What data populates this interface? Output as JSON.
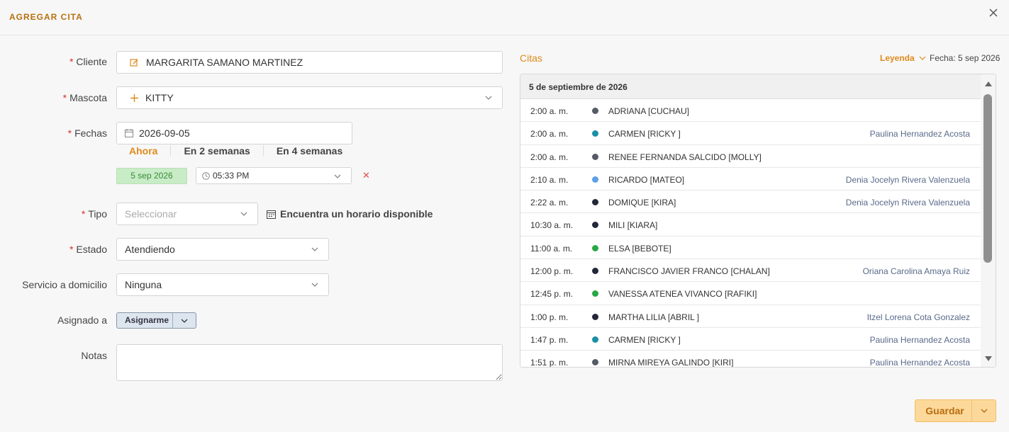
{
  "header": {
    "title": "AGREGAR CITA",
    "close_icon": "close-icon"
  },
  "form": {
    "cliente": {
      "label": "Cliente",
      "required_mark": "*",
      "value": "MARGARITA SAMANO MARTINEZ",
      "icon": "edit-icon"
    },
    "mascota": {
      "label": "Mascota",
      "required_mark": "*",
      "value": "KITTY",
      "icon": "plus-icon"
    },
    "fechas": {
      "label": "Fechas",
      "required_mark": "*",
      "value": "2026-09-05",
      "icon": "calendar-icon",
      "quick_links": [
        "Ahora",
        "En 2 semanas",
        "En 4 semanas"
      ],
      "selected_chip": "5 sep 2026",
      "time_value": "05:33 PM",
      "remove_mark": "✕"
    },
    "tipo": {
      "label": "Tipo",
      "required_mark": "*",
      "placeholder": "Seleccionar",
      "find_slot": "Encuentra un horario disponible"
    },
    "estado": {
      "label": "Estado",
      "required_mark": "*",
      "value": "Atendiendo"
    },
    "servicio": {
      "label": "Servicio a domicilio",
      "value": "Ninguna"
    },
    "asignado": {
      "label": "Asignado a",
      "button": "Asignarme"
    },
    "notas": {
      "label": "Notas",
      "value": ""
    }
  },
  "citas": {
    "title": "Citas",
    "legend_label": "Leyenda",
    "fecha_label": "Fecha: 5 sep 2026",
    "day_header": "5 de septiembre de 2026",
    "colors": {
      "gray": "#555b66",
      "teal": "#1a8fa6",
      "blue": "#5ea0e8",
      "dark": "#232838",
      "green": "#28a745"
    },
    "rows": [
      {
        "time": "2:00 a. m.",
        "color": "#555b66",
        "name": "ADRIANA [CUCHAU]",
        "vet": ""
      },
      {
        "time": "2:00 a. m.",
        "color": "#1a8fa6",
        "name": "CARMEN [RICKY ]",
        "vet": "Paulina Hernandez Acosta"
      },
      {
        "time": "2:00 a. m.",
        "color": "#555b66",
        "name": "RENEE FERNANDA SALCIDO [MOLLY]",
        "vet": ""
      },
      {
        "time": "2:10 a. m.",
        "color": "#5ea0e8",
        "name": "RICARDO [MATEO]",
        "vet": "Denia Jocelyn Rivera Valenzuela"
      },
      {
        "time": "2:22 a. m.",
        "color": "#232838",
        "name": "DOMIQUE [KIRA]",
        "vet": "Denia Jocelyn Rivera Valenzuela"
      },
      {
        "time": "10:30 a. m.",
        "color": "#232838",
        "name": "MILI [KIARA]",
        "vet": ""
      },
      {
        "time": "11:00 a. m.",
        "color": "#28a745",
        "name": "ELSA [BEBOTE]",
        "vet": ""
      },
      {
        "time": "12:00 p. m.",
        "color": "#232838",
        "name": "FRANCISCO JAVIER FRANCO [CHALAN]",
        "vet": "Oriana Carolina Amaya Ruiz"
      },
      {
        "time": "12:45 p. m.",
        "color": "#28a745",
        "name": "VANESSA ATENEA VIVANCO [RAFIKI]",
        "vet": ""
      },
      {
        "time": "1:00 p. m.",
        "color": "#232838",
        "name": "MARTHA LILIA [ABRIL ]",
        "vet": "Itzel Lorena Cota Gonzalez"
      },
      {
        "time": "1:47 p. m.",
        "color": "#1a8fa6",
        "name": "CARMEN [RICKY ]",
        "vet": "Paulina Hernandez Acosta"
      },
      {
        "time": "1:51 p. m.",
        "color": "#555b66",
        "name": "MIRNA MIREYA GALINDO [KIRI]",
        "vet": "Paulina Hernandez Acosta"
      }
    ]
  },
  "footer": {
    "save_label": "Guardar"
  }
}
